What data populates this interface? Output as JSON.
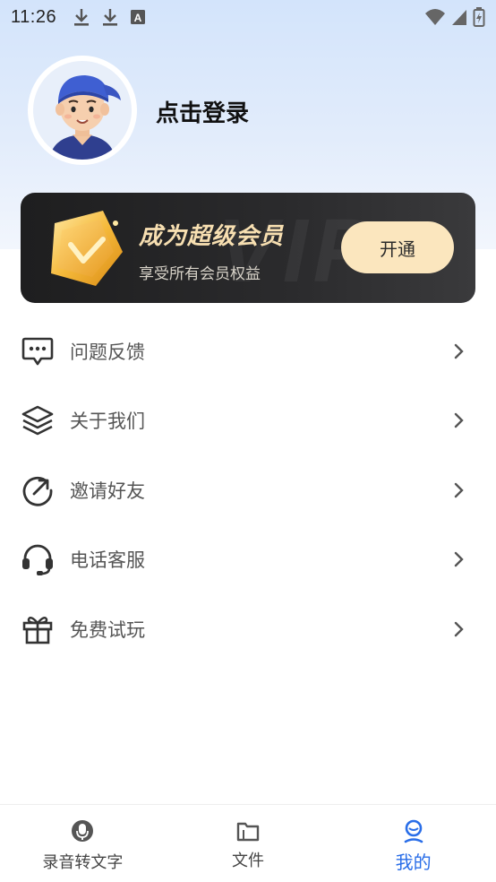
{
  "status_bar": {
    "time": "11:26",
    "left_icons": [
      "download-icon",
      "download-icon",
      "text-a-icon"
    ],
    "right_icons": [
      "wifi-icon",
      "signal-icon",
      "battery-charging-icon"
    ]
  },
  "profile": {
    "login_text": "点击登录",
    "avatar": "avatar-cartoon-boy"
  },
  "vip_card": {
    "title": "成为超级会员",
    "subtitle": "享受所有会员权益",
    "button_label": "开通",
    "watermark": "VIP",
    "colors": {
      "title": "#f7dfb1",
      "button_bg": "#fbe6be",
      "card_bg": "#242426"
    }
  },
  "menu": {
    "items": [
      {
        "label": "问题反馈",
        "icon": "chat-bubble-icon"
      },
      {
        "label": "关于我们",
        "icon": "layers-icon"
      },
      {
        "label": "邀请好友",
        "icon": "share-arrow-icon"
      },
      {
        "label": "电话客服",
        "icon": "headset-icon"
      },
      {
        "label": "免费试玩",
        "icon": "gift-icon"
      }
    ]
  },
  "tabbar": {
    "tabs": [
      {
        "label": "录音转文字",
        "icon": "microphone-icon",
        "active": false
      },
      {
        "label": "文件",
        "icon": "folder-icon",
        "active": false
      },
      {
        "label": "我的",
        "icon": "profile-icon",
        "active": true
      }
    ],
    "active_color": "#2a6ee8"
  }
}
